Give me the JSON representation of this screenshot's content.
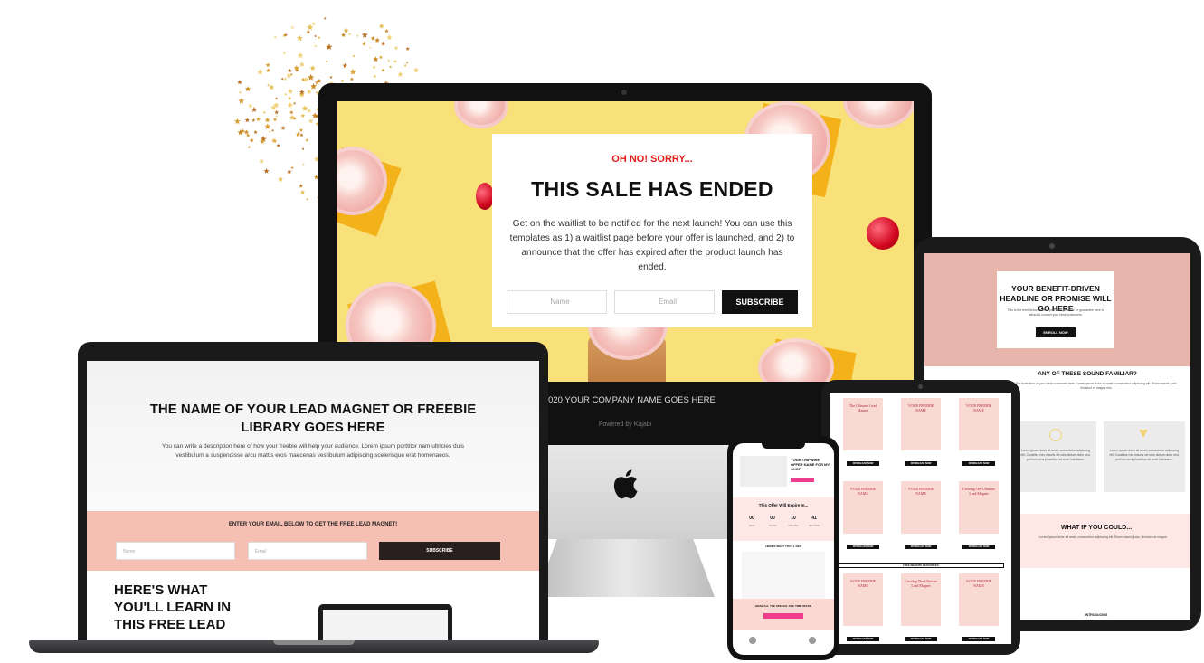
{
  "imac": {
    "sale_kicker": "OH NO! SORRY...",
    "sale_title": "THIS SALE HAS ENDED",
    "sale_description": "Get on the waitlist to be notified for the next launch! You can use this templates as 1) a waitlist page before your offer is launched, and 2) to announce that the offer has expired after the product launch has ended.",
    "name_placeholder": "Name",
    "email_placeholder": "Email",
    "subscribe_label": "SUBSCRIBE",
    "footer_copyright": "© 2020 YOUR COMPANY NAME GOES HERE",
    "footer_powered": "Powered by Kajabi"
  },
  "laptop": {
    "title": "THE NAME OF YOUR LEAD MAGNET OR FREEBIE LIBRARY GOES HERE",
    "description": "You can write a description here of how your freebie will help your audience. Lorem ipsum porttitor nam ultricies duis vestibulum a suspendisse arcu mattis eros maecenas vestibulum adipiscing scelerisque erat homenaeos.",
    "band_label": "ENTER YOUR EMAIL BELOW TO GET THE FREE LEAD MAGNET!",
    "name_placeholder": "Name",
    "email_placeholder": "Email",
    "subscribe_label": "SUBSCRIBE",
    "learn_heading": "HERE'S WHAT YOU'LL LEARN IN THIS FREE LEAD"
  },
  "tablet": {
    "hero_title": "YOUR BENEFIT-DRIVEN HEADLINE OR PROMISE WILL GO HERE",
    "hero_desc": "This is the brief description of your offer promise or guarantee here to attract & convert your ideal customers.",
    "enroll_label": "ENROLL NOW",
    "section_title": "ANY OF THESE SOUND FAMILIAR?",
    "section_desc": "The frustration of your ideal customers here. Lorem ipsum dolor sit amet, consectetur adipiscing elit. Etiam mauris justo, tincidunt et magna nec.",
    "card1_text": "Lorem ipsum dolor sit amet, consectetur adipiscing elit. Curabitur nec mauris vel odio dictum dolor sed, pretium urna phasellus sit amet habitasse.",
    "card2_text": "Lorem ipsum dolor sit amet, consectetur adipiscing elit. Curabitur nec mauris vel odio dictum dolor sed, pretium urna phasellus sit amet habitasse.",
    "what_title": "WHAT IF YOU COULD...",
    "what_desc": "Lorem ipsum dolor sit amet, consectetur adipiscing elit. Etiam mauris justo, tincidunt at magna.",
    "bottom_label": "INTRODUCING"
  },
  "small_tablet": {
    "thumbs": [
      {
        "title": "The Ultimate Lead Magnet",
        "btn": "DOWNLOAD NOW"
      },
      {
        "title": "YOUR FREEBIE NAME",
        "btn": "DOWNLOAD NOW"
      },
      {
        "title": "YOUR FREEBIE NAME",
        "btn": "DOWNLOAD NOW"
      },
      {
        "title": "YOUR FREEBIE NAME",
        "btn": "DOWNLOAD NOW"
      },
      {
        "title": "YOUR FREEBIE NAME",
        "btn": "DOWNLOAD NOW"
      },
      {
        "title": "Creating The Ultimate Lead Magnet",
        "btn": "DOWNLOAD NOW"
      },
      {
        "title": "YOUR FREEBIE NAME",
        "btn": "DOWNLOAD NOW"
      },
      {
        "title": "Creating The Ultimate Lead Magnet",
        "btn": "DOWNLOAD NOW"
      },
      {
        "title": "YOUR FREEBIE NAME",
        "btn": "DOWNLOAD NOW"
      }
    ],
    "band_label": "FREE WEBSITE RESOURCES"
  },
  "phone": {
    "hero_title": "YOUR TRIPWIRE OFFER NAME FOR MY SHOP",
    "countdown_title": "This Offer Will Expire In...",
    "countdown": [
      {
        "value": "00",
        "label": "DAYS"
      },
      {
        "value": "00",
        "label": "HOURS"
      },
      {
        "value": "10",
        "label": "MINUTES"
      },
      {
        "value": "41",
        "label": "SECONDS"
      }
    ],
    "section_label": "HERE'S WHAT YOU'LL GET",
    "band_label": "GRAB ALL THE SPECIAL ONE TIME OFFER"
  }
}
